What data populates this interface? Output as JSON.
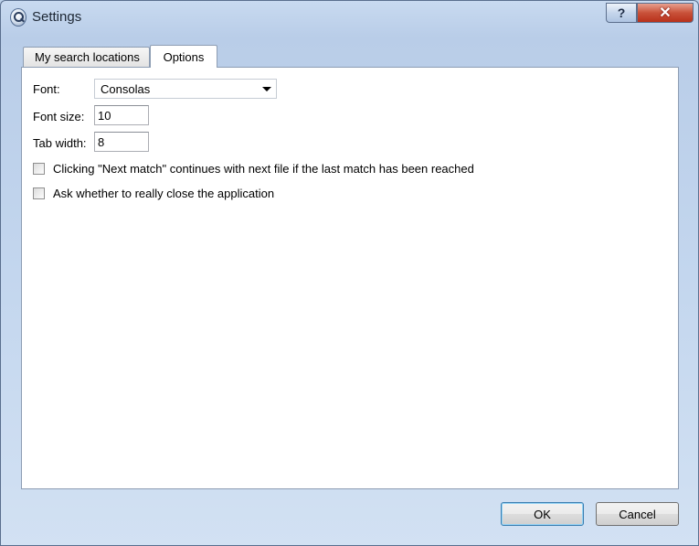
{
  "window": {
    "title": "Settings",
    "help_label": "?",
    "close_label": "✕"
  },
  "tabs": [
    {
      "label": "My search locations",
      "selected": false
    },
    {
      "label": "Options",
      "selected": true
    }
  ],
  "options": {
    "font_label": "Font:",
    "font_value": "Consolas",
    "font_size_label": "Font size:",
    "font_size_value": "10",
    "tab_width_label": "Tab width:",
    "tab_width_value": "8",
    "checkboxes": [
      {
        "label": "Clicking \"Next match\" continues with next file if the last match has been reached",
        "checked": false
      },
      {
        "label": "Ask whether to really close the application",
        "checked": false
      }
    ]
  },
  "buttons": {
    "ok_label": "OK",
    "cancel_label": "Cancel"
  }
}
